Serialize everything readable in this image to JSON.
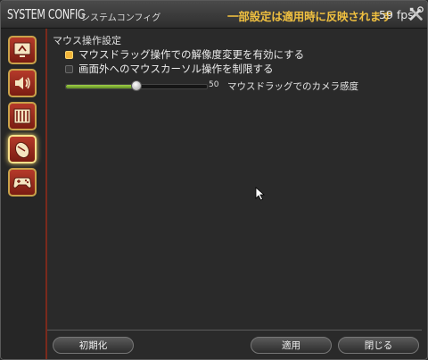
{
  "title": {
    "main": "SYSTEM CONFIG",
    "sub": "システムコンフィグ"
  },
  "notice": "一部設定は適用時に反映されます",
  "fps": "59 fps",
  "sidebar": {
    "categories": [
      {
        "icon": "display-settings-icon"
      },
      {
        "icon": "sound-speaker-icon"
      },
      {
        "icon": "window-blinds-icon"
      },
      {
        "icon": "mouse-icon",
        "active": true
      },
      {
        "icon": "gamepad-icon"
      }
    ]
  },
  "section_title": "マウス操作設定",
  "options": [
    {
      "label": "マウスドラッグ操作での解像度変更を有効にする",
      "checked": true
    },
    {
      "label": "画面外へのマウスカーソル操作を制限する",
      "checked": false
    }
  ],
  "slider": {
    "value": "50",
    "label": "マウスドラッグでのカメラ感度",
    "fraction": 0.5
  },
  "buttons": {
    "reset": "初期化",
    "apply": "適用",
    "close": "閉じる"
  },
  "colors": {
    "accent": "#f0c040",
    "slider_fill": "#8fc03a",
    "sidebar_border": "#7a2a1c"
  }
}
